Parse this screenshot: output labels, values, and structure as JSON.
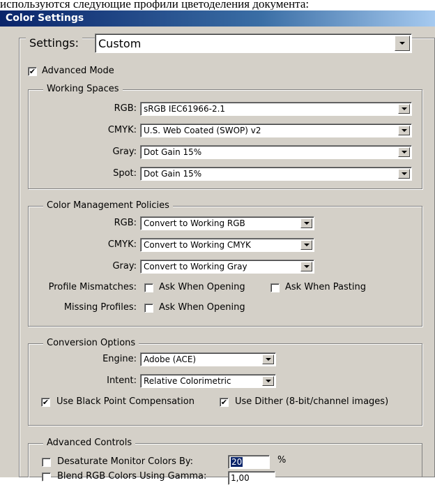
{
  "caption": "используются следующие профили цветоделения документа:",
  "window_title": "Color Settings",
  "settings": {
    "label": "Settings:",
    "value": "Custom"
  },
  "advanced_mode": {
    "label": "Advanced Mode",
    "checked": true
  },
  "working_spaces": {
    "title": "Working Spaces",
    "rows": [
      {
        "label": "RGB:",
        "value": "sRGB IEC61966-2.1"
      },
      {
        "label": "CMYK:",
        "value": "U.S. Web Coated (SWOP) v2"
      },
      {
        "label": "Gray:",
        "value": "Dot Gain 15%"
      },
      {
        "label": "Spot:",
        "value": "Dot Gain 15%"
      }
    ]
  },
  "policies": {
    "title": "Color Management Policies",
    "rows": [
      {
        "label": "RGB:",
        "value": "Convert to Working RGB"
      },
      {
        "label": "CMYK:",
        "value": "Convert to Working CMYK"
      },
      {
        "label": "Gray:",
        "value": "Convert to Working Gray"
      }
    ],
    "profile_mismatches": {
      "label": "Profile Mismatches:",
      "ask_opening": "Ask When Opening",
      "ask_pasting": "Ask When Pasting"
    },
    "missing_profiles": {
      "label": "Missing Profiles:",
      "ask_opening": "Ask When Opening"
    }
  },
  "conversion": {
    "title": "Conversion Options",
    "engine_label": "Engine:",
    "engine_value": "Adobe (ACE)",
    "intent_label": "Intent:",
    "intent_value": "Relative Colorimetric",
    "black_point": "Use Black Point Compensation",
    "dither": "Use Dither (8-bit/channel images)"
  },
  "advanced": {
    "title": "Advanced Controls",
    "desaturate_label": "Desaturate Monitor Colors By:",
    "desaturate_value": "20",
    "desaturate_unit": "%",
    "blend_label": "Blend RGB Colors Using Gamma:",
    "blend_value": "1,00"
  },
  "check_mark": "✔",
  "colors": {
    "title_bar": "#0a246a",
    "dialog_bg": "#d4d0c8",
    "selection": "#0a246a"
  }
}
